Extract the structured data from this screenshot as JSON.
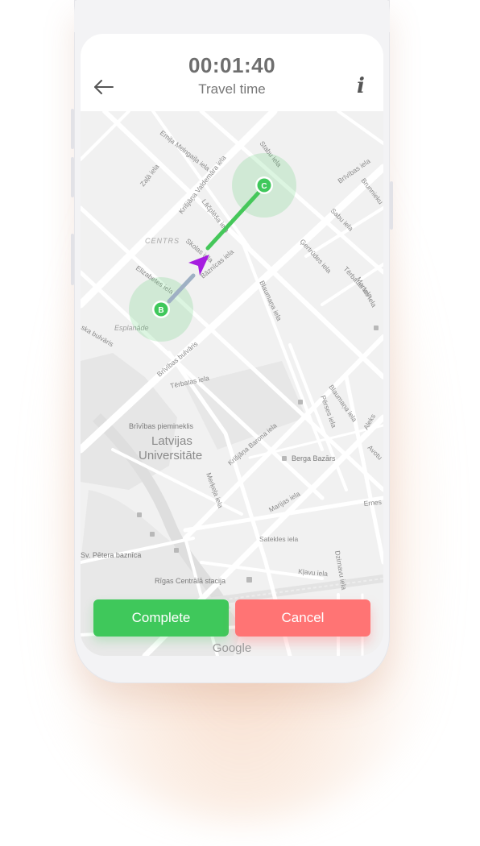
{
  "header": {
    "timer": "00:01:40",
    "subtitle": "Travel time",
    "back_icon": "arrow-left-icon",
    "info_icon": "info-icon",
    "info_glyph": "i"
  },
  "map": {
    "streets": [
      "Emiļa Melngaiļa iela",
      "Zaļā iela",
      "Krišjāņa Valdemāra iela",
      "Lāčplēša iela",
      "Stabu iela",
      "Brīvības iela",
      "Brunnieku",
      "Sabu iela",
      "Ģertrūdes iela",
      "Tērbatas iela",
      "Martas iela",
      "Skolas iela",
      "Elizabetes iela",
      "Bāznīcas iela",
      "Blaumaņa iela",
      "Brīvības bulvāris",
      "ska bulvāris",
      "Tērbatas iela",
      "Krišjāņa Barona iela",
      "Pērses iela",
      "Blaumaņa iela",
      "Aleks",
      "Avotu",
      "Merķeļa iela",
      "Marijas iela",
      "Ernes",
      "Satekles iela",
      "Dzirnavu iela",
      "Kļavu iela",
      "Centrāla"
    ],
    "places": [
      "CENTRS",
      "Esplanāde",
      "Brīvības piemineklis",
      "Latvijas",
      "Universitāte",
      "Berga Bazārs",
      "Sv. Pētera baznīca",
      "Rīgas Centrālā stacija"
    ],
    "markers": [
      {
        "label": "C",
        "color": "#3fc85b"
      },
      {
        "label": "B",
        "color": "#3fc85b"
      }
    ],
    "navigation_icon": "navigation-arrow-icon",
    "navigation_color": "#a61de0",
    "route_color": "#45c75a",
    "traveled_color": "#9fb0c4"
  },
  "actions": {
    "complete_label": "Complete",
    "cancel_label": "Cancel"
  },
  "attribution": "Google"
}
